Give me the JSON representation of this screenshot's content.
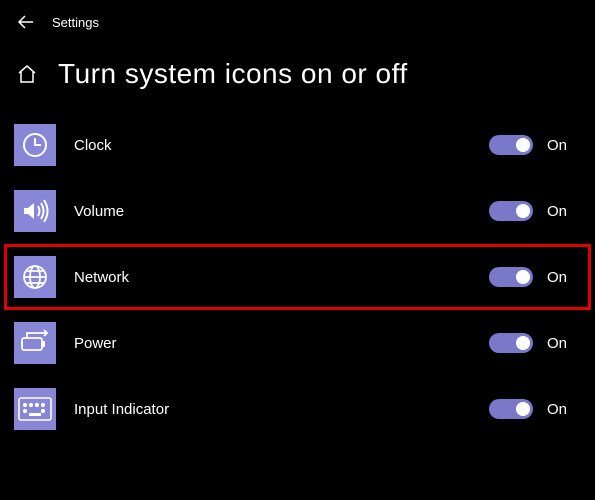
{
  "header": {
    "app_name": "Settings"
  },
  "page": {
    "title": "Turn system icons on or off"
  },
  "items": [
    {
      "icon": "clock",
      "label": "Clock",
      "state": "On",
      "highlighted": false
    },
    {
      "icon": "volume",
      "label": "Volume",
      "state": "On",
      "highlighted": false
    },
    {
      "icon": "network",
      "label": "Network",
      "state": "On",
      "highlighted": true
    },
    {
      "icon": "power",
      "label": "Power",
      "state": "On",
      "highlighted": false
    },
    {
      "icon": "keyboard",
      "label": "Input Indicator",
      "state": "On",
      "highlighted": false
    }
  ],
  "colors": {
    "accent": "#8886d6",
    "highlight_border": "#e00000"
  }
}
